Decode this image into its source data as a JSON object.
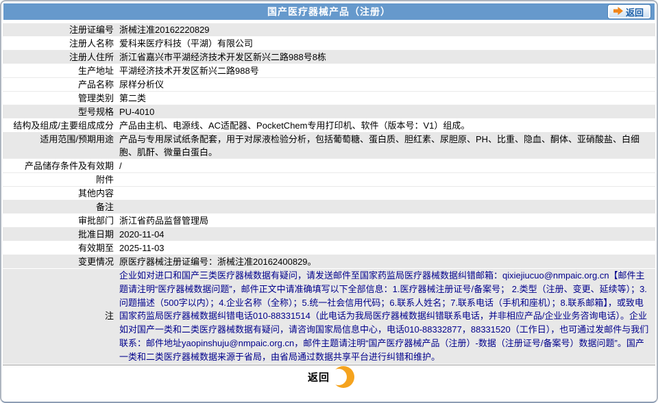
{
  "header": {
    "title": "国产医疗器械产品（注册）",
    "back_label": "返回",
    "back_arrow_icon": "arrow-right-icon"
  },
  "colors": {
    "header_bg": "#6699CC",
    "shaded_row_bg": "#E8E8E8",
    "note_text": "#00008B",
    "accent_orange": "#F5A31E"
  },
  "rows": [
    {
      "label": "注册证编号",
      "value": "浙械注准20162220829"
    },
    {
      "label": "注册人名称",
      "value": "爱科来医疗科技（平湖）有限公司"
    },
    {
      "label": "注册人住所",
      "value": "浙江省嘉兴市平湖经济技术开发区新兴二路988号8栋"
    },
    {
      "label": "生产地址",
      "value": "平湖经济技术开发区新兴二路988号"
    },
    {
      "label": "产品名称",
      "value": "尿样分析仪"
    },
    {
      "label": "管理类别",
      "value": "第二类"
    },
    {
      "label": "型号规格",
      "value": "PU-4010"
    },
    {
      "label": "结构及组成/主要组成成分",
      "value": "产品由主机、电源线、AC适配器、PocketChem专用打印机、软件（版本号：V1）组成。"
    },
    {
      "label": "适用范围/预期用途",
      "value": "产品与专用尿试纸条配套，用于对尿液检验分析，包括葡萄糖、蛋白质、胆红素、尿胆原、PH、比重、隐血、酮体、亚硝酸盐、白细胞、肌酐、微量白蛋白。"
    },
    {
      "label": "产品储存条件及有效期",
      "value": "/"
    },
    {
      "label": "附件",
      "value": ""
    },
    {
      "label": "其他内容",
      "value": ""
    },
    {
      "label": "备注",
      "value": ""
    },
    {
      "label": "审批部门",
      "value": "浙江省药品监督管理局"
    },
    {
      "label": "批准日期",
      "value": "2020-11-04"
    },
    {
      "label": "有效期至",
      "value": "2025-11-03"
    },
    {
      "label": "变更情况",
      "value": "原医疗器械注册证编号：浙械注准20162400829。"
    },
    {
      "label": "注",
      "value": "企业如对进口和国产三类医疗器械数据有疑问，请发送邮件至国家药监局医疗器械数据纠错邮箱：qixiejiucuo@nmpaic.org.cn【邮件主题请注明“医疗器械数据问题”，邮件正文中请准确填写以下全部信息：1.医疗器械注册证号/备案号； 2.类型（注册、变更、延续等）；3.问题描述（500字以内）；4.企业名称（全称）；5.统一社会信用代码；6.联系人姓名；7.联系电话（手机和座机）；8.联系邮箱】，或致电国家药监局医疗器械数据纠错电话010-88331514（此电话为我局医疗器械数据纠错联系电话，并非相应产品/企业业务咨询电话）。企业如对国产一类和二类医疗器械数据有疑问，请咨询国家局信息中心，电话010-88332877，88331520（工作日），也可通过发邮件与我们联系：邮件地址yaopinshuju@nmpaic.org.cn，邮件主题请注明“国产医疗器械产品（注册）-数据（注册证号/备案号）数据问题”。国产一类和二类医疗器械数据来源于省局，由省局通过数据共享平台进行纠错和维护。"
    }
  ],
  "footer": {
    "back_label": "返回",
    "back_circle_icon": "crescent-circle-icon"
  }
}
